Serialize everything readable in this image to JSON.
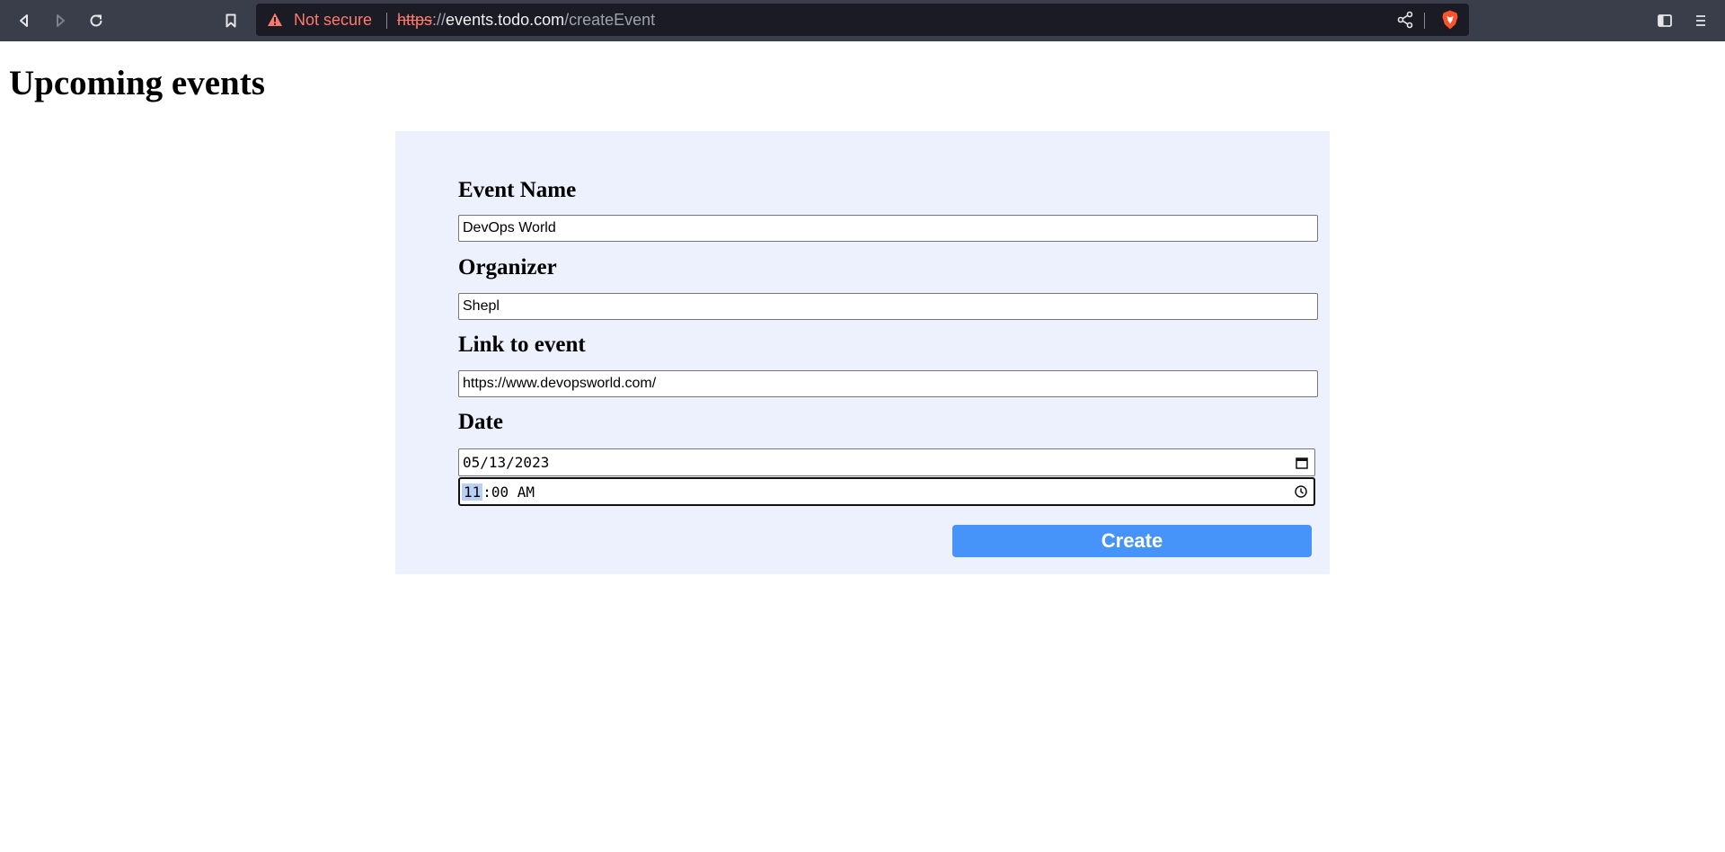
{
  "browser": {
    "security_label": "Not secure",
    "url": {
      "scheme": "https",
      "separator": "://",
      "host": "events.todo.com",
      "path": "/createEvent"
    },
    "icons": {
      "back": "back-arrow-icon",
      "forward": "forward-arrow-icon",
      "reload": "reload-icon",
      "bookmark": "bookmark-icon",
      "warning": "warning-triangle-icon",
      "share": "share-icon",
      "brave": "brave-shield-icon",
      "sidebar": "sidebar-toggle-icon",
      "menu": "hamburger-menu-icon"
    }
  },
  "page": {
    "title": "Upcoming events"
  },
  "form": {
    "event_name": {
      "label": "Event Name",
      "value": "DevOps World"
    },
    "organizer": {
      "label": "Organizer",
      "value": "Shepl"
    },
    "link": {
      "label": "Link to event",
      "value": "https://www.devopsworld.com/"
    },
    "date": {
      "label": "Date",
      "date_value": "05/13/2023",
      "time_hour": "11",
      "time_rest": ":00 AM"
    },
    "submit_label": "Create"
  },
  "colors": {
    "panel_bg": "#edf1fd",
    "button_bg": "#4694fa",
    "toolbar_bg": "#3a3d4a",
    "urlbar_bg": "#1a1b24",
    "insecure_red": "#ff7a6c"
  }
}
